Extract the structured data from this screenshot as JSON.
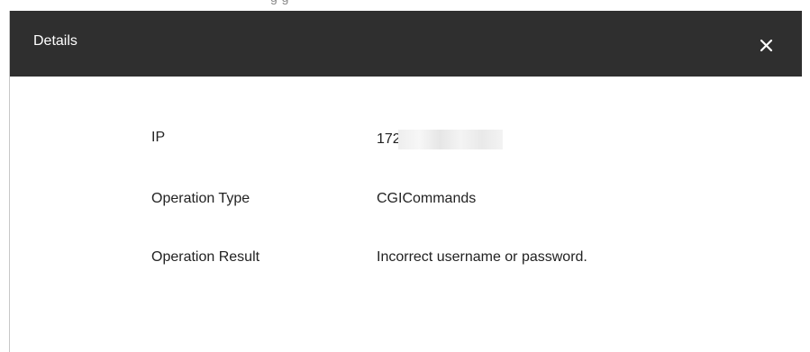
{
  "background_page": {
    "partial_text": "g                              g"
  },
  "dialog": {
    "title": "Details",
    "close_glyph": "✕",
    "rows": [
      {
        "label": "IP",
        "value": "172"
      },
      {
        "label": "Operation Type",
        "value": "CGICommands"
      },
      {
        "label": "Operation Result",
        "value": "Incorrect username or password."
      }
    ]
  },
  "colors": {
    "header_bg": "#2f2f2f",
    "header_text": "#ffffff",
    "body_bg": "#ffffff",
    "text": "#222222"
  }
}
